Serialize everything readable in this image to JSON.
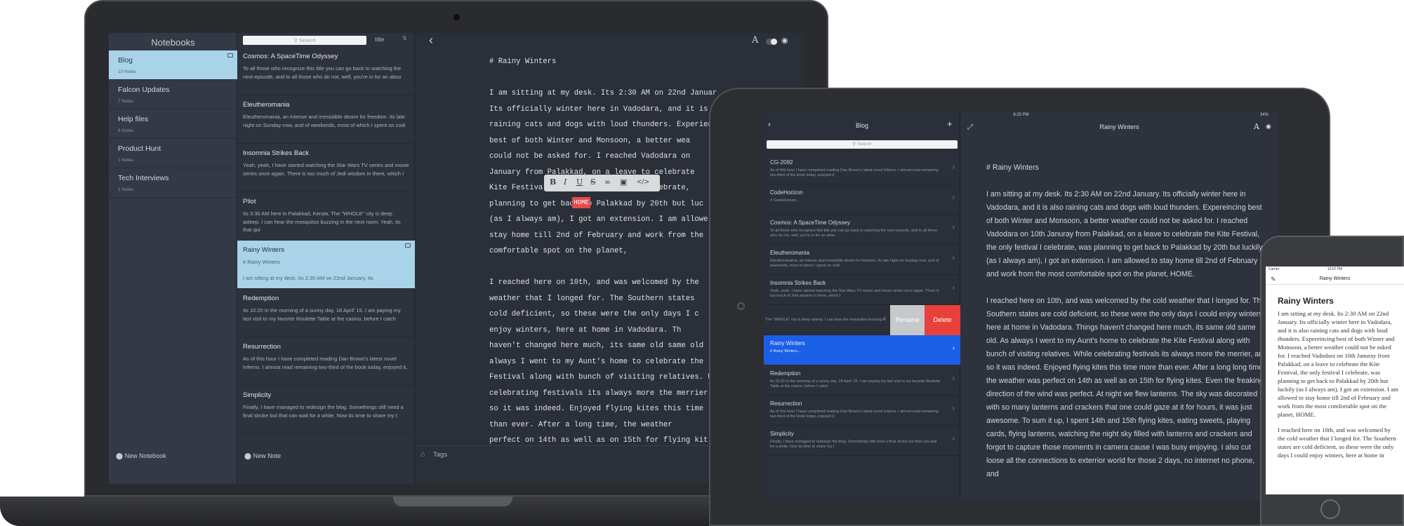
{
  "laptop": {
    "notebooks_title": "Notebooks",
    "notebooks": [
      {
        "name": "Blog",
        "count": "10 Notes"
      },
      {
        "name": "Falcon Updates",
        "count": "7 Notes"
      },
      {
        "name": "Help files",
        "count": "6 Notes"
      },
      {
        "name": "Product Hunt",
        "count": "1 Notes"
      },
      {
        "name": "Tech Interviews",
        "count": "1 Notes"
      }
    ],
    "new_notebook": "New Notebook",
    "search_placeholder": "Search",
    "sort_label": "title",
    "notes": [
      {
        "title": "Cosmos: A SpaceTime Odyssey",
        "preview": "To all those who recognize this title you can go back to watching the next episode, and to all those who do not, well, you're in for an abso"
      },
      {
        "title": "Eleutheromania",
        "preview": "Eleutheromania, an intense and irresistible desire for freedom. Its late night on Sunday now, and of weekends, most of which I spent on codi"
      },
      {
        "title": "Insomnia Strikes Back",
        "preview": "Yeah, yeah, I have started watching the Star Wars TV series and movie series once again. There is too much of Jedi wisdom in there, which I"
      },
      {
        "title": "Pilot",
        "preview": "Its 3:30 AM here in Palakkad, Kerala. The \"WHOLE\" city is deep asleep. I can hear the mosquitos buzzing in the next room. Yeah, its that qui"
      },
      {
        "title": "Rainy Winters",
        "preview": "# Rainy Winters\n\nI am sitting at my desk. Its 2:30 AM on 22nd January. Its"
      },
      {
        "title": "Redemption",
        "preview": "Its 10:20 in the morning of a sunny day, 18 April' 15. I am paying my last visit to my favorite Roulette Table at the casino, before I catch"
      },
      {
        "title": "Resurrection",
        "preview": "As of this hour I have completed reading Dan Brown's latest novel Inferno. I almost read remaining two-third of the book today, enjoyed it,"
      },
      {
        "title": "Simplicity",
        "preview": "Finally, I have managed to redesign the blog. Somethings still need a final stroke but that can wait for a while. Now its time to share my t"
      }
    ],
    "new_note": "New Note",
    "editor_lines": [
      "# Rainy Winters",
      "",
      "I am sitting at my desk. Its 2:30 AM on 22nd Januar",
      "Its officially winter here in Vadodara, and it is",
      "raining cats and dogs with loud thunders. Experien",
      "best of both Winter and Monsoon, a better wea",
      "could not be asked for. I reached Vadodara on",
      "January from Palakkad, on a leave to celebrate",
      "Kite Festival, the only festival I celebrate,",
      "planning to get back to Palakkad by 20th but luc",
      "(as I always am), I got an extension. I am allowe",
      "stay home till 2nd of February and work from the",
      "comfortable spot on the planet,",
      "",
      "I reached here on 10th, and was welcomed by the",
      "weather that I longed for. The Southern states",
      "cold deficient, so these were the only days I c",
      "enjoy winters, here at home in Vadodara. Th",
      "haven't changed here much, its same old same old",
      "always I went to my Aunt's home to celebrate the",
      "Festival along with bunch of visiting relatives. W",
      "celebrating festivals its always more the merrier.",
      "so it was indeed. Enjoyed flying kites this time",
      "than ever. After a long time, the weather",
      "perfect on 14th as well as on 15th for flying kit"
    ],
    "highlight_word": "HOME",
    "tags_label": "Tags"
  },
  "ipad": {
    "status": {
      "carrier": "iPad",
      "time": "6:25 PM",
      "battery": "34%"
    },
    "list_title": "Blog",
    "search_placeholder": "Search",
    "notes": [
      {
        "title": "CG-2092",
        "preview": "As of this hour I have completed reading Dan Brown's latest novel Inferno. I almost read remaining two-third of the book today, enjoyed it,"
      },
      {
        "title": "CodeHorizon",
        "preview": "# CodeHorizon..."
      },
      {
        "title": "Cosmos: A SpaceTime Odyssey",
        "preview": "To all those who recognize this title you can go back to watching the next episode, and to all those who do not, well, you're in for an abso"
      },
      {
        "title": "Eleutheromania",
        "preview": "Eleutheromania, an intense and irresistible desire for freedom. Its late night on Sunday now, and of weekends, most of which I spent on codi"
      },
      {
        "title": "Insomnia Strikes Back",
        "preview": "Yeah, yeah, I have started watching the Star Wars TV series and movie series once again. There is too much of Jedi wisdom in there, which I"
      },
      {
        "title": "",
        "preview": "The \"WHOLE\" city is deep asleep. I can hear the mosquitos buzzing in"
      },
      {
        "title": "Rainy Winters",
        "preview": "# Rainy Winters..."
      },
      {
        "title": "Redemption",
        "preview": "Its 10:20 in the morning of a sunny day, 18 April' 15. I am paying my last visit to my favorite Roulette Table at the casino, before I catch"
      },
      {
        "title": "Resurrection",
        "preview": "As of this hour I have completed reading Dan Brown's latest novel Inferno. I almost read remaining two-third of the book today, enjoyed it,"
      },
      {
        "title": "Simplicity",
        "preview": "Finally, I have managed to redesign the blog. Somethings still need a final stroke but that can wait for a while. Now its time to share my t"
      }
    ],
    "rename_label": "Rename",
    "delete_label": "Delete",
    "note_title": "Rainy Winters",
    "heading": "# Rainy Winters",
    "paragraph1": "I am sitting at my desk. Its 2:30 AM on 22nd January. Its officially winter here in Vadodara, and it is also raining cats and dogs with loud thunders. Expereincing best of both Winter and Monsoon, a better weather could not be asked for. I reached Vadodara on 10th Januray from Palakkad, on a leave to celebrate the Kite Festival, the only festival I celebrate, was planning to get back to Palakkad by 20th but luckily (as I always am), I got an extension. I am allowed to stay home till 2nd of February and work from the most comfortable spot on the planet, HOME.",
    "paragraph2": "I reached here on 10th, and was welcomed by the cold weather that I longed for. The Southern states are cold deficient, so these were the only days I could enjoy winters, here at home in Vadodara. Things haven't changed here much, its same old same old. As always I went to my Aunt's home to celebrate the Kite Festival along with bunch of visiting relatives. While celebrating festivals its always more the merrier, and so it was indeed. Enjoyed flying kites this time more than ever. After a long long time, the weather was perfect on 14th as well as on 15th for flying kites. Even the freaking direction of the wind was perfect. At night we flew lanterns. The sky was decorated with so many lanterns and crackers that one could gaze at it for hours, it was just awesome. To sum it up, I spent 14th and 15th flying kites, eating sweets, playing cards, flying lanterns, watching the night sky filled with lanterns and crackers and forgot to capture those moments in camera cause I was busy enjoying. I also cut loose all the connections to exterrior world for those 2 days, no internet no phone, and"
  },
  "iphone": {
    "status": {
      "carrier": "Carrier",
      "time": "10:07 PM"
    },
    "nav_title": "Rainy Winters",
    "heading": "Rainy Winters",
    "paragraph1": "I am sitting at my desk. Its 2:30 AM on 22nd January. Its officially winter here in Vadodara, and it is also raining cats and dogs with loud thunders. Expereincing best of both Winter and Monsoon, a better weather could not be asked for. I reached Vadodara on 10th Januray from Palakkad, on a leave to celebrate the Kite Festival, the only festival I celebrate, was planning to get back to Palakkad by 20th but luckily (as I always am), I got an extension. I am allowed to stay home till 2nd of February and work from the most comfortable spot on the planet, HOME.",
    "paragraph2": "I reached here on 10th, and was welcomed by the cold weather that I longed for. The Southern states are cold deficient, so these were the only days I could enjoy winters, here at home in"
  },
  "colors": {
    "selection_blue": "#a9d3e8",
    "ipad_selected": "#1b5fe6",
    "delete_red": "#e8403a",
    "highlight_red": "#e54b4b"
  }
}
